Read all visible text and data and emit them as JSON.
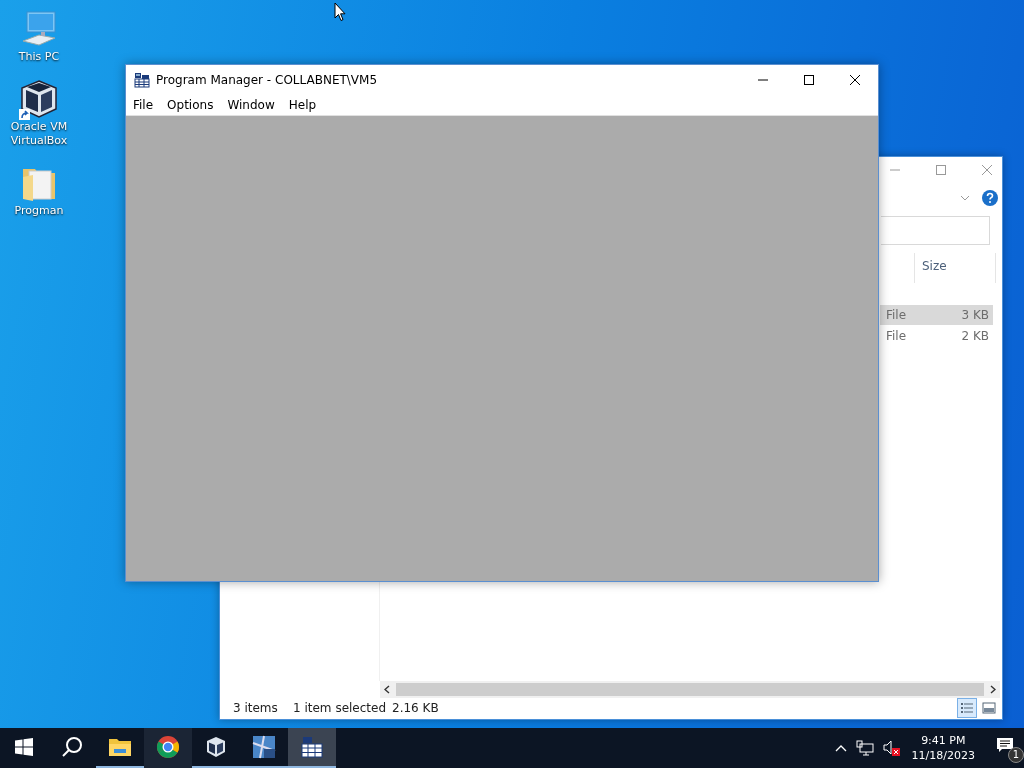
{
  "desktop_icons": [
    {
      "label": "This PC",
      "kind": "computer"
    },
    {
      "label": "Oracle VM VirtualBox",
      "kind": "cube",
      "shortcut": true
    },
    {
      "label": "Progman",
      "kind": "folder"
    }
  ],
  "explorer_window": {
    "column_header": "Size",
    "rows": [
      {
        "type": "File",
        "size": "3 KB",
        "selected": true
      },
      {
        "type": "File",
        "size": "2 KB",
        "selected": false
      }
    ],
    "status": {
      "item_count": "3 items",
      "selection": "1 item selected",
      "size": "2.16 KB"
    },
    "view_buttons": [
      {
        "kind": "details",
        "selected": true
      },
      {
        "kind": "tiles",
        "selected": false
      }
    ]
  },
  "program_manager": {
    "title": "Program Manager - COLLABNET\\VM5",
    "menu": [
      "File",
      "Options",
      "Window",
      "Help"
    ]
  },
  "taskbar": {
    "apps": [
      {
        "kind": "start",
        "running": false,
        "active": false,
        "hovered": false
      },
      {
        "kind": "search",
        "running": false,
        "active": false,
        "hovered": false
      },
      {
        "kind": "explorer",
        "running": true,
        "active": false,
        "hovered": false
      },
      {
        "kind": "chrome",
        "running": false,
        "active": false,
        "hovered": true
      },
      {
        "kind": "cube",
        "running": true,
        "active": false,
        "hovered": false
      },
      {
        "kind": "xp",
        "running": true,
        "active": false,
        "hovered": false
      },
      {
        "kind": "progman",
        "running": true,
        "active": true,
        "hovered": false
      }
    ],
    "volume_muted": true,
    "clock": {
      "time": "9:41 PM",
      "date": "11/18/2023"
    },
    "notification_count": "1"
  }
}
